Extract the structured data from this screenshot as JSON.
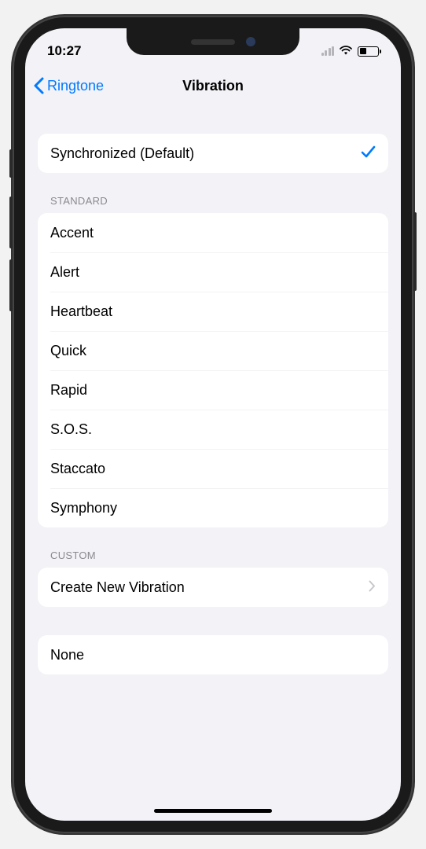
{
  "status": {
    "time": "10:27"
  },
  "nav": {
    "back_label": "Ringtone",
    "title": "Vibration"
  },
  "default_section": {
    "item": {
      "label": "Synchronized (Default)",
      "selected": true
    }
  },
  "standard": {
    "header": "STANDARD",
    "items": [
      {
        "label": "Accent"
      },
      {
        "label": "Alert"
      },
      {
        "label": "Heartbeat"
      },
      {
        "label": "Quick"
      },
      {
        "label": "Rapid"
      },
      {
        "label": "S.O.S."
      },
      {
        "label": "Staccato"
      },
      {
        "label": "Symphony"
      }
    ]
  },
  "custom": {
    "header": "CUSTOM",
    "create_label": "Create New Vibration"
  },
  "none": {
    "label": "None"
  },
  "colors": {
    "accent": "#007aff",
    "background": "#f2f2f7",
    "groupBg": "#ffffff",
    "separator": "#e5e5ea",
    "sectionHeader": "#8a8a8e"
  }
}
